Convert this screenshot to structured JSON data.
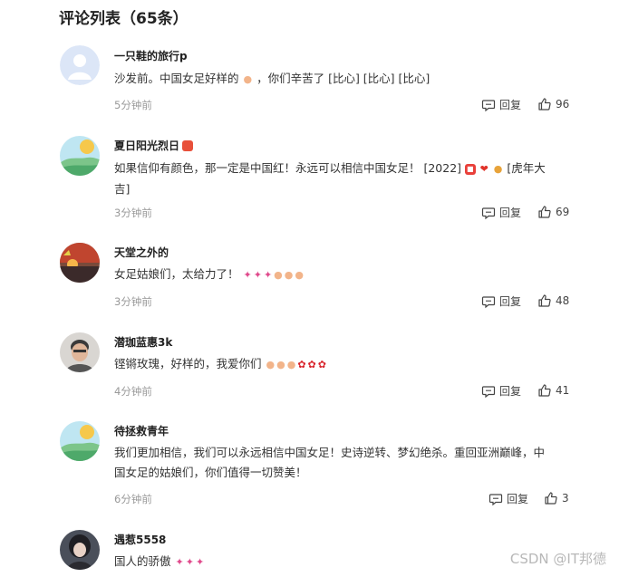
{
  "header": {
    "title": "评论列表（65条）"
  },
  "actions": {
    "reply_label": "回复"
  },
  "comments": [
    {
      "username": "一只鞋的旅行p",
      "text_before": "沙发前。中国女足好样的",
      "text_after": "，你们辛苦了 [比心] [比心] [比心]",
      "time": "5分钟前",
      "likes": "96",
      "avatar": "default-avatar"
    },
    {
      "username": "夏日阳光烈日",
      "line1": "如果信仰有颜色，那一定是中国红！永远可以相信中国女足！ [2022]",
      "line1_tail": "[虎年大",
      "line2": "吉]",
      "time": "3分钟前",
      "likes": "69",
      "avatar": "landscape-avatar"
    },
    {
      "username": "天堂之外的",
      "text": "女足姑娘们，太给力了！",
      "time": "3分钟前",
      "likes": "48",
      "avatar": "sunset-avatar"
    },
    {
      "username": "潜珈蓝惠3k",
      "text": "铿锵玫瑰，好样的，我爱你们",
      "time": "4分钟前",
      "likes": "41",
      "avatar": "man-photo-avatar"
    },
    {
      "username": "待拯救青年",
      "line1": "我们更加相信，我们可以永远相信中国女足！史诗逆转、梦幻绝杀。重回亚洲巅峰，中",
      "line2": "国女足的姑娘们，你们值得一切赞美！",
      "time": "6分钟前",
      "likes": "3",
      "avatar": "landscape-avatar"
    },
    {
      "username": "遇惹5558",
      "text": "国人的骄傲",
      "avatar": "girl-photo-avatar"
    }
  ],
  "watermark": "CSDN @IT邦德"
}
